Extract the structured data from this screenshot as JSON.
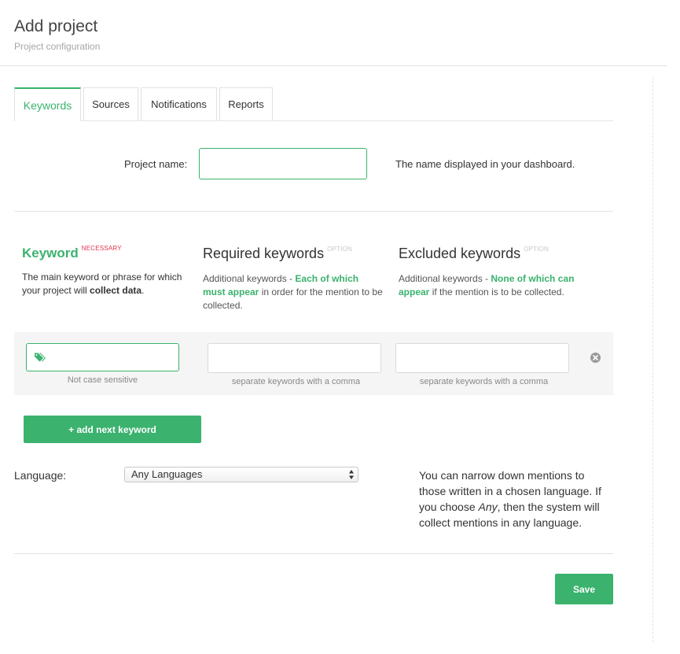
{
  "header": {
    "title": "Add project",
    "subtitle": "Project configuration"
  },
  "tabs": [
    {
      "label": "Keywords",
      "active": true
    },
    {
      "label": "Sources",
      "active": false
    },
    {
      "label": "Notifications",
      "active": false
    },
    {
      "label": "Reports",
      "active": false
    }
  ],
  "project_name": {
    "label": "Project name:",
    "value": "",
    "help": "The name displayed in your dashboard."
  },
  "columns": {
    "keyword": {
      "title": "Keyword",
      "tag": "NECESSARY",
      "desc_pre": "The main keyword or phrase for which your project will ",
      "desc_bold": "collect data",
      "desc_post": "."
    },
    "required": {
      "title": "Required keywords",
      "tag": "OPTION",
      "desc_pre": "Additional keywords - ",
      "desc_green": "Each of which must appear",
      "desc_post": " in order for the mention to be collected."
    },
    "excluded": {
      "title": "Excluded keywords",
      "tag": "OPTION",
      "desc_pre": "Additional keywords - ",
      "desc_green": "None of which can appear",
      "desc_post": " if the mention is to be collected."
    }
  },
  "keyword_row": {
    "keyword_value": "",
    "keyword_hint": "Not case sensitive",
    "required_value": "",
    "required_hint": "separate keywords with a comma",
    "excluded_value": "",
    "excluded_hint": "separate keywords with a comma",
    "remove_icon": "remove-circle-icon",
    "tag_icon": "tags-icon"
  },
  "add_keyword_label": "+ add next keyword",
  "language": {
    "label": "Language:",
    "selected": "Any Languages",
    "help_pre": "You can narrow down mentions to those written in a chosen language. If you choose ",
    "help_em": "Any",
    "help_post": ", then the system will collect mentions in any language."
  },
  "save_label": "Save",
  "colors": {
    "accent": "#3bb26e",
    "necessary_tag": "#e3324f"
  }
}
